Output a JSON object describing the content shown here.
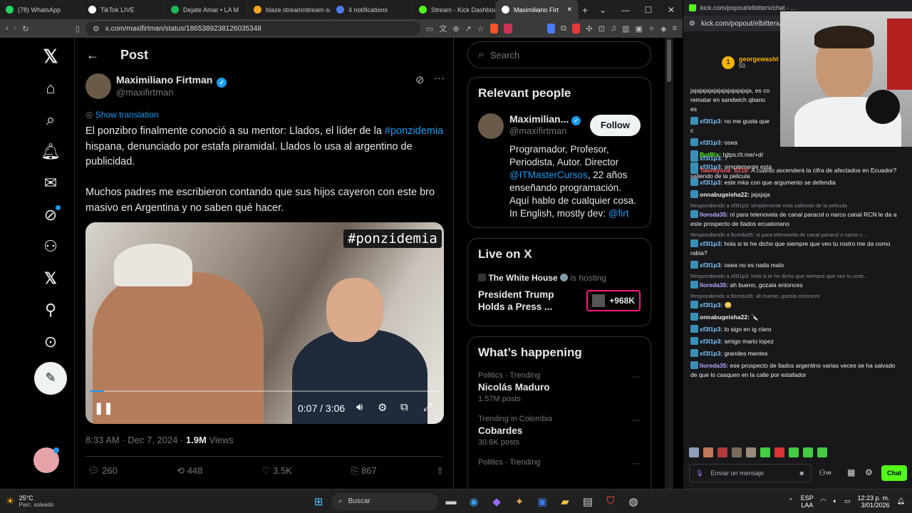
{
  "browser": {
    "tabs": [
      {
        "label": "(78) WhatsApp",
        "color": "#25d366"
      },
      {
        "label": "TikTok LIVE",
        "color": "#ffffff"
      },
      {
        "label": "Dejate Amar • LA M",
        "color": "#1db954"
      },
      {
        "label": "blaze.stream/stream-se",
        "color": "#f5a623"
      },
      {
        "label": "4 notifications",
        "color": "#4a7cf7"
      },
      {
        "label": "Stream - Kick Dashboa",
        "color": "#53fc18"
      },
      {
        "label": "Maximiliano Firt",
        "color": "#ffffff",
        "active": true
      }
    ],
    "url": "x.com/maxifirtman/status/1865389238126035348"
  },
  "x": {
    "header_title": "Post",
    "author": {
      "name": "Maximiliano Firtman",
      "handle": "@maxifirtman"
    },
    "show_translation": "Show translation",
    "tweet_text": {
      "line1": "El ponzibro finalmente conoció a su mentor: Llados, el líder de la",
      "hashtag": "#ponzidemia",
      "line2": " hispana, denunciado por estafa piramidal. Llados lo usa al argentino de publicidad.",
      "paragraph2": "Muchos padres me escribieron contando que sus hijos cayeron con este bro masivo en Argentina y no saben qué hacer."
    },
    "video": {
      "overlay_tag": "#ponzidemia",
      "time": "0:07 / 3:06",
      "progress": 0.04
    },
    "meta": {
      "time": "8:33 AM · Dec 7, 2024 · ",
      "views_count": "1.9M",
      "views_label": " Views"
    },
    "actions": {
      "replies": "260",
      "reposts": "448",
      "likes": "3.5K",
      "bookmarks": "867"
    },
    "search_placeholder": "Search",
    "relevant": {
      "title": "Relevant people",
      "name": "Maximilian...",
      "handle": "@maxifirtman",
      "follow_label": "Follow",
      "bio_a": "Programador, Profesor, Periodista, Autor. Director ",
      "bio_link": "@ITMasterCursos",
      "bio_b": ", 22 años enseñando programación. Aquí hablo de cualquier cosa. In English, mostly dev: ",
      "bio_link2": "@firt"
    },
    "live": {
      "title": "Live on X",
      "host": "The White House",
      "hosting_label": "is hosting",
      "headline": "President Trump Holds a Press ...",
      "count": "+968K"
    },
    "happening": {
      "title": "What’s happening",
      "items": [
        {
          "context": "Politics · Trending",
          "name": "Nicolás Maduro",
          "posts": "1.57M posts"
        },
        {
          "context": "Trending in Colombia",
          "name": "Cobardes",
          "posts": "30.6K posts"
        },
        {
          "context": "Politics · Trending",
          "name": "",
          "posts": ""
        }
      ]
    }
  },
  "chat": {
    "url": "kick.com/popout/elbitterx/chat",
    "tab_label": "kick.com/popout/elbitterx/chat - ...",
    "top_gifter": {
      "rank": "1",
      "name": "georgewasht",
      "amount": "50"
    },
    "messages": [
      {
        "reply": "",
        "user": "",
        "color": "#efeff1",
        "text": "jajajajajajajajajajajajaja, es co rematar en sandwich qbano es"
      },
      {
        "reply": "",
        "user": "xf3l1p3:",
        "color": "#7cc7ff",
        "text": "no me gusta que c"
      },
      {
        "reply": "",
        "user": "xf3l1p3:",
        "color": "#7cc7ff",
        "text": "osea"
      },
      {
        "reply": "",
        "user": "BotRix:",
        "color": "#53fc18",
        "text": "https://t.me/+d/"
      },
      {
        "reply": "",
        "user": "xf3l1p3:",
        "color": "#7cc7ff",
        "text": "simplemente esta saliendo de la pelicula"
      },
      {
        "reply": "",
        "user": "xf3l1p3:",
        "color": "#7cc7ff",
        "text": "?"
      },
      {
        "reply": "",
        "user": "Twentyone_0210:",
        "color": "#ff6b6b",
        "text": "A cuánto ascenderá la cifra de afectados en Ecuador?"
      },
      {
        "reply": "",
        "user": "xf3l1p3:",
        "color": "#7cc7ff",
        "text": "este mka con que argumento se defendia"
      },
      {
        "reply": "",
        "user": "onnabugeisha22:",
        "color": "#efeff1",
        "text": "jajajaja"
      },
      {
        "reply": "Respondiendo a xf3l1p3: simplemente esta saliendo de la pelicula",
        "user": "lloreda35:",
        "color": "#b9a6ff",
        "text": "ni para telenovela de canal paracol o narco canal RCN le da a este prospecto de llados ecuatoriano"
      },
      {
        "reply": "Respondiendo a lloreda35: ni para telenovela de canal paracol o narco c...",
        "user": "xf3l1p3:",
        "color": "#7cc7ff",
        "text": "hola si te he dicho que siempre que veo tu rostro me da como rabia?"
      },
      {
        "reply": "",
        "user": "xf3l1p3:",
        "color": "#7cc7ff",
        "text": "osea no es nada malo"
      },
      {
        "reply": "Respondiendo a xf3l1p3: hola si te he dicho que siempre que veo tu rostr...",
        "user": "lloreda35:",
        "color": "#b9a6ff",
        "text": "ah bueno, gozala entonces"
      },
      {
        "reply": "Respondiendo a lloreda35: ah bueno, gozala entonces",
        "user": "xf3l1p3:",
        "color": "#7cc7ff",
        "text": "😳"
      },
      {
        "reply": "",
        "user": "onnabugeisha22:",
        "color": "#efeff1",
        "text": "🔪"
      },
      {
        "reply": "",
        "user": "xf3l1p3:",
        "color": "#7cc7ff",
        "text": "lo sigo en ig claro"
      },
      {
        "reply": "",
        "user": "xf3l1p3:",
        "color": "#7cc7ff",
        "text": "amigo mario lopez"
      },
      {
        "reply": "",
        "user": "xf3l1p3:",
        "color": "#7cc7ff",
        "text": "grandes mentes"
      },
      {
        "reply": "",
        "user": "lloreda35:",
        "color": "#b9a6ff",
        "text": "ese prospecto de llados argentino varias veces se ha salvado de que lo casquen en la calle por estafador"
      }
    ],
    "input_placeholder": "Enviar un mensaje",
    "send_label": "Chat"
  },
  "taskbar": {
    "weather_temp": "25°C",
    "weather_desc": "Parc. soleado",
    "search_label": "Buscar",
    "lang": "ESP",
    "lang2": "LAA",
    "time": "12:23 p. m.",
    "date": "3/01/2026"
  }
}
